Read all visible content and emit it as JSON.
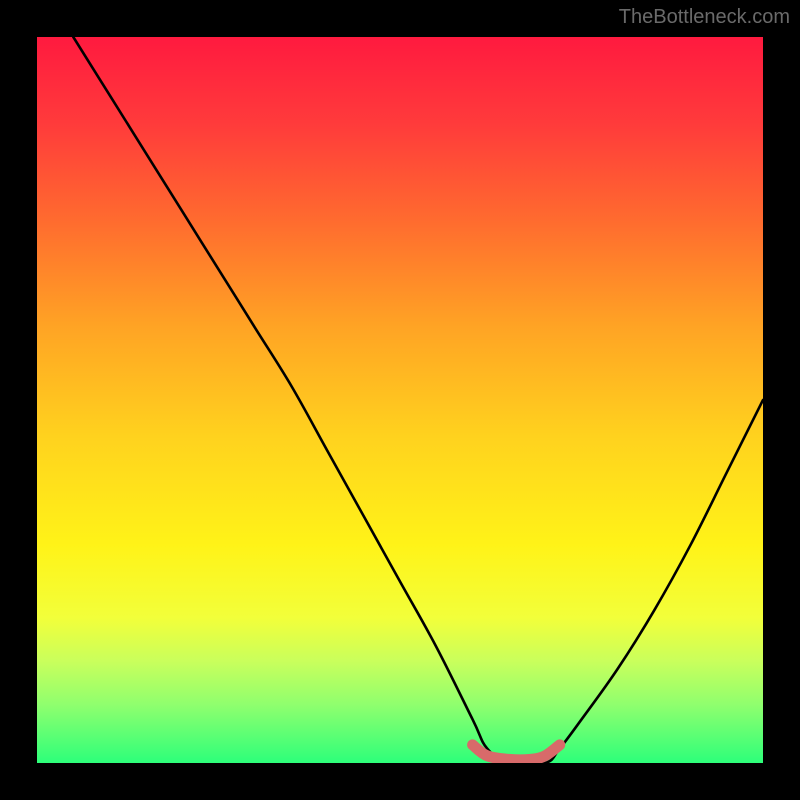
{
  "watermark": "TheBottleneck.com",
  "chart_data": {
    "type": "line",
    "title": "",
    "xlabel": "",
    "ylabel": "",
    "xlim": [
      0,
      100
    ],
    "ylim": [
      0,
      100
    ],
    "grid": false,
    "legend": false,
    "series": [
      {
        "name": "bottleneck-curve",
        "x": [
          5,
          10,
          15,
          20,
          25,
          30,
          35,
          40,
          45,
          50,
          55,
          60,
          62,
          65,
          70,
          72,
          75,
          80,
          85,
          90,
          95,
          100
        ],
        "y": [
          100,
          92,
          84,
          76,
          68,
          60,
          52,
          43,
          34,
          25,
          16,
          6,
          2,
          0,
          0,
          2,
          6,
          13,
          21,
          30,
          40,
          50
        ]
      },
      {
        "name": "flat-minimum-marker",
        "x": [
          60,
          62,
          65,
          68,
          70,
          72
        ],
        "y": [
          2.5,
          1,
          0.5,
          0.5,
          1,
          2.5
        ]
      }
    ],
    "annotations": []
  },
  "colors": {
    "curve": "#000000",
    "marker": "#d86a6a",
    "background_top": "#ff1a3f",
    "background_bottom": "#2dff7a",
    "frame": "#000000"
  }
}
